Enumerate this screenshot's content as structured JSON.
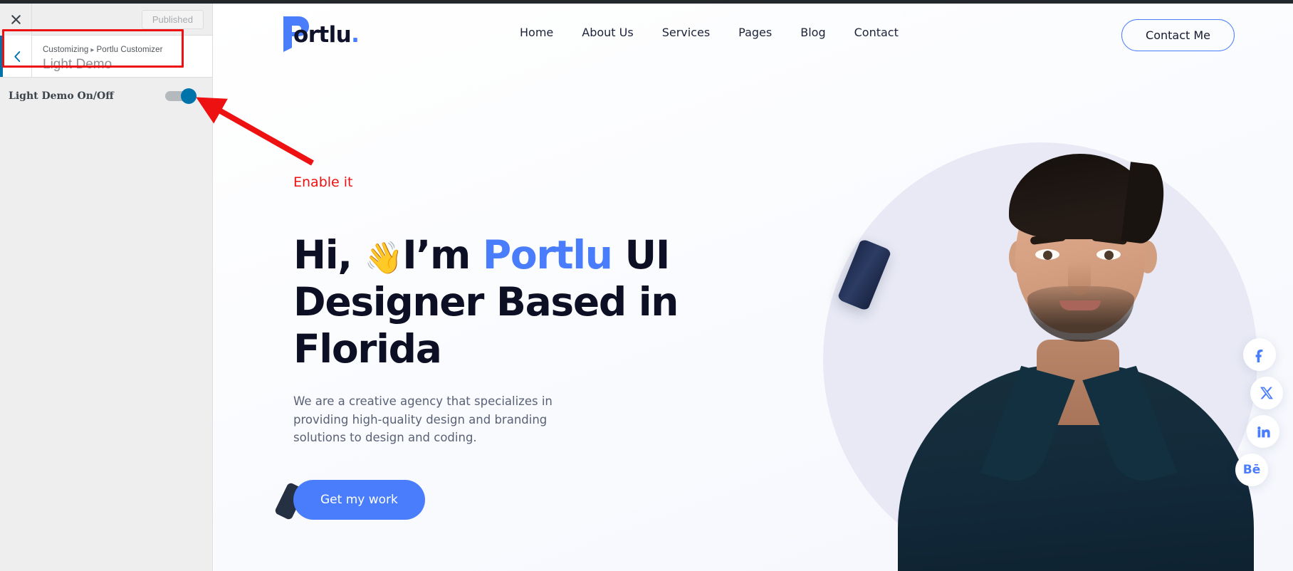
{
  "customizer": {
    "close_icon": "close-icon",
    "publish_label": "Published",
    "back_icon": "chevron-left-icon",
    "breadcrumb_root": "Customizing",
    "breadcrumb_separator": "▸",
    "breadcrumb_parent": "Portlu Customizer",
    "panel_title": "Light Demo",
    "control": {
      "label": "Light Demo On/Off",
      "state": "on"
    },
    "accent_color": "#0073aa",
    "highlight_color": "#ee1111"
  },
  "annotations": {
    "enable_note": "Enable it",
    "arrow_name": "red-arrow-pointer",
    "box_name": "red-highlight-box"
  },
  "site": {
    "logo": {
      "mark": "portlu-p-mark",
      "word": "ortlu",
      "dot": "."
    },
    "nav": [
      {
        "label": "Home"
      },
      {
        "label": "About Us"
      },
      {
        "label": "Services"
      },
      {
        "label": "Pages"
      },
      {
        "label": "Blog"
      },
      {
        "label": "Contact"
      }
    ],
    "contact_button": "Contact Me",
    "hero": {
      "title_part1": "Hi,",
      "title_wave": "👋",
      "title_part2": "I’m",
      "title_accent": "Portlu",
      "title_part3": "UI Designer Based in Florida",
      "paragraph": "We are a creative agency that specializes in providing high-quality design and branding solutions to design and coding.",
      "cta_label": "Get my work",
      "accent_color": "#4a7dfc",
      "heading_color": "#0d0f24"
    },
    "socials": [
      {
        "name": "facebook-icon",
        "glyph": "f"
      },
      {
        "name": "x-twitter-icon",
        "glyph": "𝕏"
      },
      {
        "name": "linkedin-icon",
        "glyph": "in"
      },
      {
        "name": "behance-icon",
        "glyph": "Bē"
      }
    ]
  }
}
